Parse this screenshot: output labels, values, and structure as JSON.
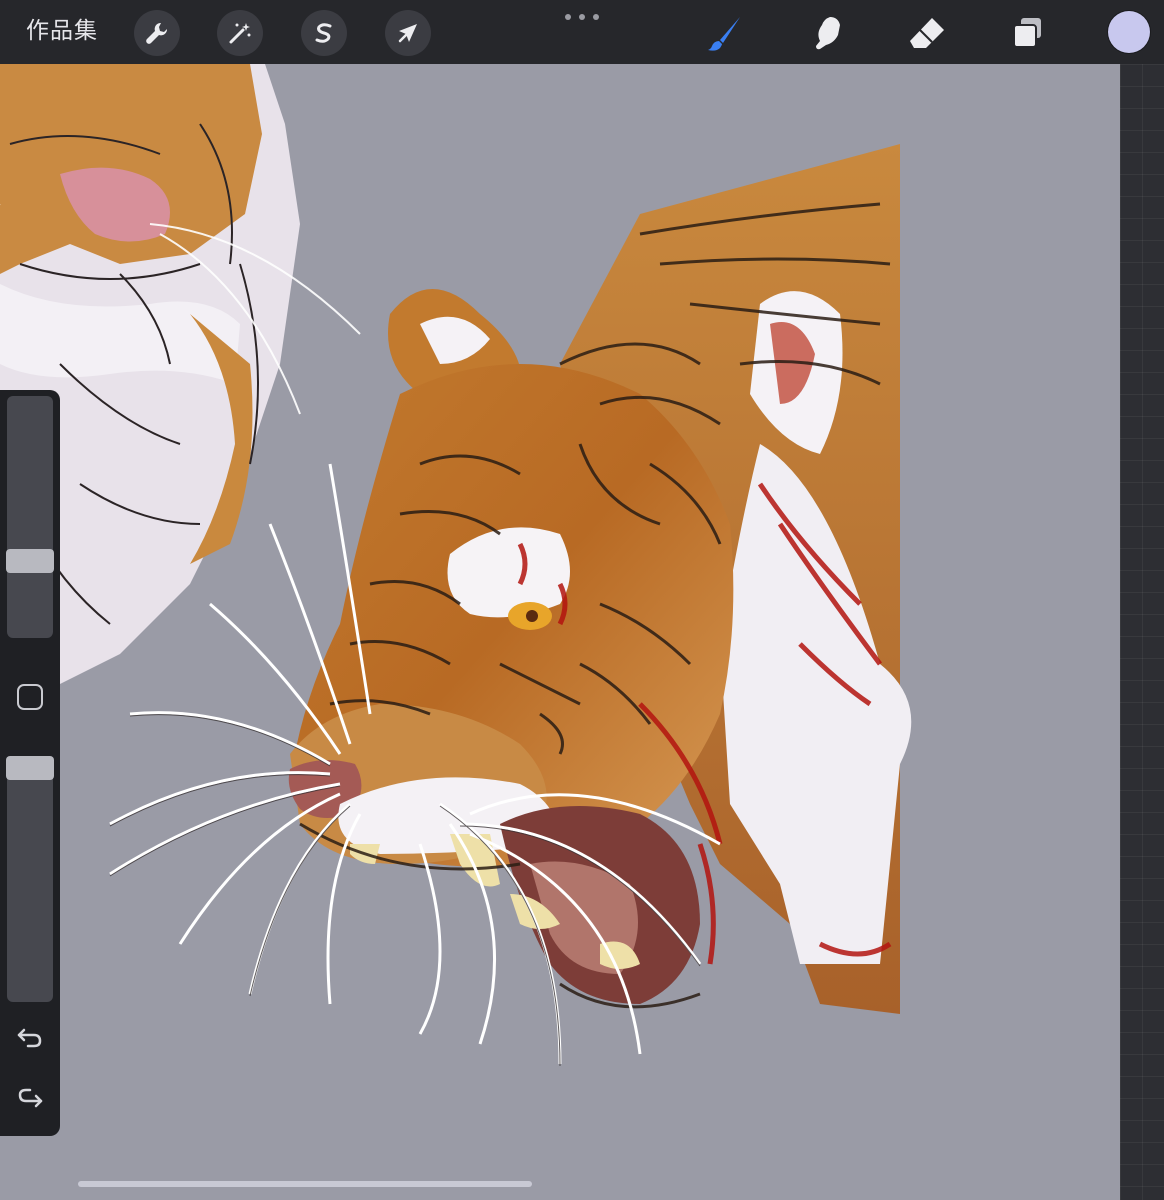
{
  "app": {
    "gallery_label": "作品集"
  },
  "toolbar": {
    "left_tools": [
      {
        "name": "actions",
        "icon": "wrench-icon"
      },
      {
        "name": "adjustments",
        "icon": "magic-wand-icon"
      },
      {
        "name": "selection",
        "icon": "selection-s-icon"
      },
      {
        "name": "transform",
        "icon": "arrow-cursor-icon"
      }
    ],
    "more_icon": "more-dots-icon",
    "right_tools": [
      {
        "name": "brush",
        "icon": "brush-icon",
        "active": true
      },
      {
        "name": "smudge",
        "icon": "smudge-finger-icon",
        "active": false
      },
      {
        "name": "eraser",
        "icon": "eraser-icon",
        "active": false
      },
      {
        "name": "layers",
        "icon": "layers-icon",
        "active": false
      }
    ],
    "current_color": "#c8c8ee",
    "accent_color": "#3a7ff2"
  },
  "sidebar": {
    "brush_size_level": 0.3,
    "opacity_level": 1.0,
    "undo_icon": "undo-icon",
    "redo_icon": "redo-icon",
    "modify_icon": "square-modifier-icon"
  },
  "canvas": {
    "background_color": "#9a9ba6",
    "artwork": "tiger-sketch"
  }
}
